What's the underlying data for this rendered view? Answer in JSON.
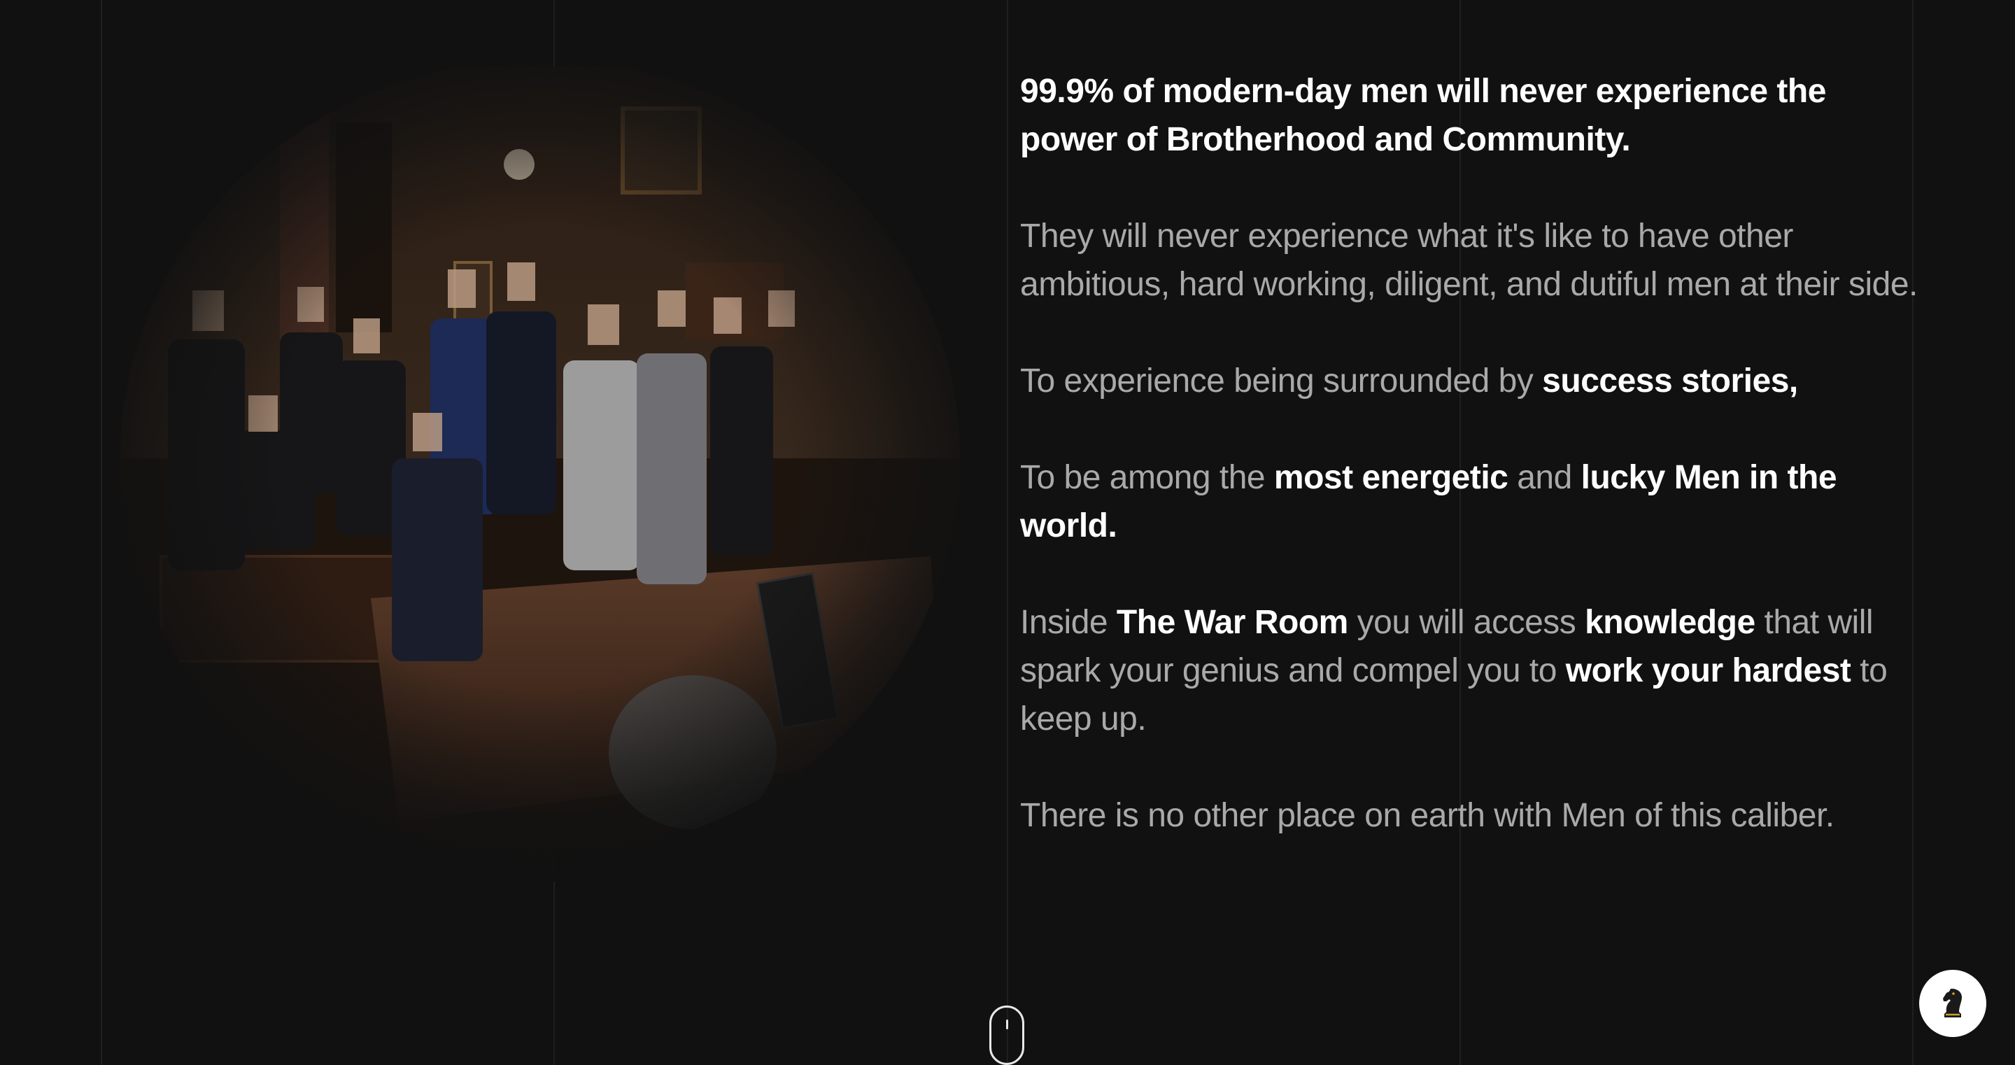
{
  "section": {
    "image": {
      "alt": "group photo in wood-paneled room",
      "icon": "group-photo"
    },
    "lead": "99.9% of modern-day men will never experience the power of Brotherhood and Community.",
    "p1": "They will never experience what it's like to have other ambitious, hard working, diligent, and dutiful men at their side.",
    "p2": {
      "text_a": "To experience being surrounded by ",
      "bold_a": "success stories,"
    },
    "p3": {
      "text_a": "To be among the ",
      "bold_a": "most energetic",
      "text_b": " and ",
      "bold_b": "lucky Men in the world."
    },
    "p4": {
      "text_a": "Inside ",
      "bold_a": "The War Room",
      "text_b": " you will access ",
      "bold_b": "knowledge",
      "text_c": " that will spark your genius and compel you to ",
      "bold_c": "work your hardest",
      "text_d": " to keep up."
    },
    "p5": "There is no other place on earth with Men of this caliber."
  },
  "scroll_indicator": {
    "icon": "mouse-scroll-icon"
  },
  "chat_button": {
    "icon": "chess-knight-icon"
  },
  "colors": {
    "background": "#111111",
    "text_muted": "#a9a9a9",
    "text_strong": "#ffffff",
    "knight_gold": "#c9a227"
  }
}
